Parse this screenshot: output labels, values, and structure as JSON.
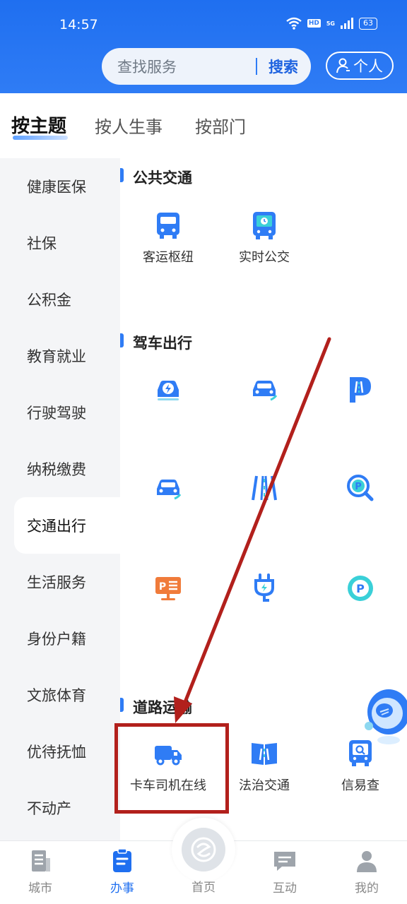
{
  "status_bar": {
    "time": "14:57",
    "hd": "HD",
    "network": "5G",
    "battery": "63"
  },
  "header": {
    "search_placeholder": "查找服务",
    "search_button": "搜索",
    "personal_button": "个人"
  },
  "tabs": [
    {
      "label": "按主题",
      "active": true
    },
    {
      "label": "按人生事",
      "active": false
    },
    {
      "label": "按部门",
      "active": false
    }
  ],
  "sidebar": {
    "items": [
      {
        "label": "健康医保"
      },
      {
        "label": "社保"
      },
      {
        "label": "公积金"
      },
      {
        "label": "教育就业"
      },
      {
        "label": "行驶驾驶"
      },
      {
        "label": "纳税缴费"
      },
      {
        "label": "交通出行",
        "active": true
      },
      {
        "label": "生活服务"
      },
      {
        "label": "身份户籍"
      },
      {
        "label": "文旅体育"
      },
      {
        "label": "优待抚恤"
      },
      {
        "label": "不动产"
      }
    ]
  },
  "sections": [
    {
      "title": "公共交通",
      "services": [
        {
          "label": "客运枢纽",
          "icon": "bus-icon"
        },
        {
          "label": "实时公交",
          "icon": "realtime-bus-icon"
        }
      ]
    },
    {
      "title": "驾车出行",
      "services": [
        {
          "label": "",
          "icon": "ev-charging-car-icon"
        },
        {
          "label": "",
          "icon": "car-icon"
        },
        {
          "label": "",
          "icon": "road-parking-icon"
        },
        {
          "label": "",
          "icon": "car-icon"
        },
        {
          "label": "",
          "icon": "road-icon"
        },
        {
          "label": "",
          "icon": "parking-search-icon"
        },
        {
          "label": "",
          "icon": "parking-screen-icon"
        },
        {
          "label": "",
          "icon": "charging-plug-icon"
        },
        {
          "label": "",
          "icon": "parking-icon"
        }
      ]
    },
    {
      "title": "道路运输",
      "services": [
        {
          "label": "卡车司机在线",
          "icon": "truck-icon"
        },
        {
          "label": "法治交通",
          "icon": "law-book-icon"
        },
        {
          "label": "信易查",
          "icon": "credit-search-icon"
        }
      ]
    }
  ],
  "bottom_nav": [
    {
      "label": "城市",
      "icon": "city-icon"
    },
    {
      "label": "办事",
      "icon": "service-icon",
      "active": true
    },
    {
      "label": "首页",
      "icon": "home-icon"
    },
    {
      "label": "互动",
      "icon": "chat-icon"
    },
    {
      "label": "我的",
      "icon": "profile-icon"
    }
  ],
  "colors": {
    "brand": "#2F7CF5",
    "highlight_box": "#B2201C",
    "arrow": "#B2201C"
  }
}
